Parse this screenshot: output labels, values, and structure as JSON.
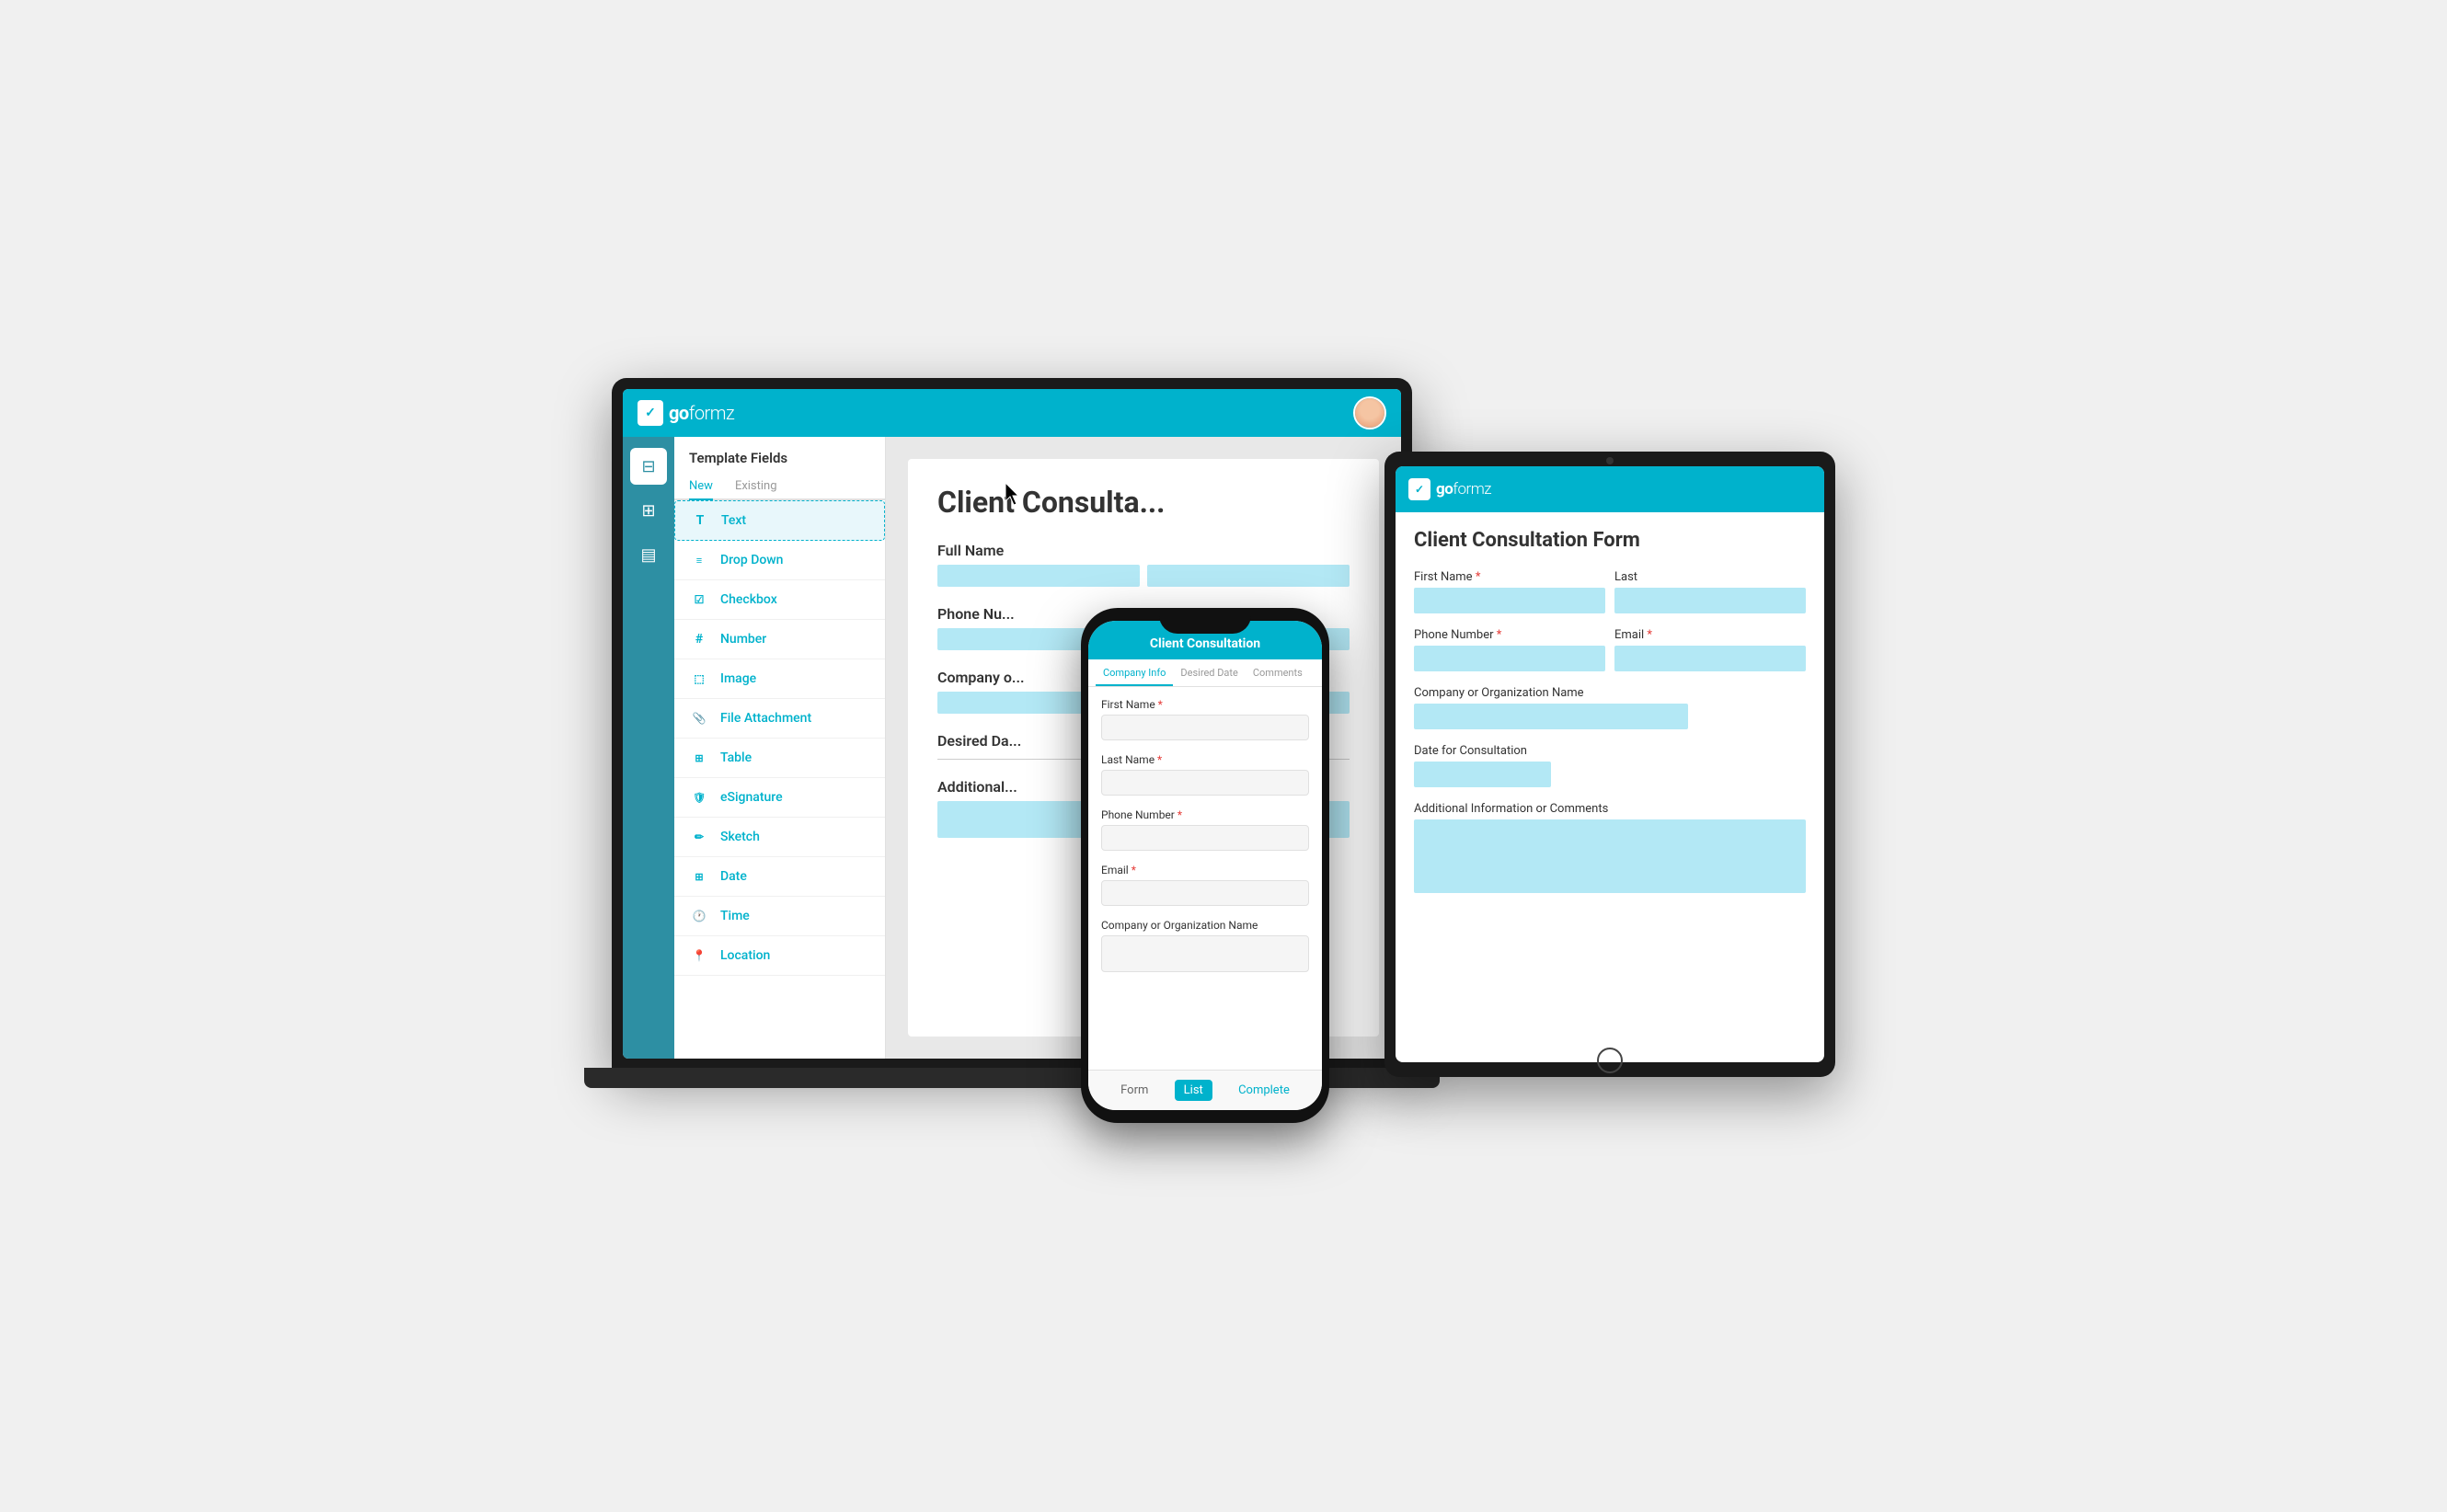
{
  "brand": {
    "name": "goformz",
    "logo_label": "✓"
  },
  "laptop": {
    "topbar_title": "goformz",
    "template_fields_title": "Template Fields",
    "tabs": {
      "new": "New",
      "existing": "Existing"
    },
    "field_types": [
      {
        "id": "text",
        "label": "Text",
        "icon": "T"
      },
      {
        "id": "dropdown",
        "label": "Drop Down",
        "icon": "≡"
      },
      {
        "id": "checkbox",
        "label": "Checkbox",
        "icon": "☑"
      },
      {
        "id": "number",
        "label": "Number",
        "icon": "#"
      },
      {
        "id": "image",
        "label": "Image",
        "icon": "🖼"
      },
      {
        "id": "file-attachment",
        "label": "File Attachment",
        "icon": "📎"
      },
      {
        "id": "table",
        "label": "Table",
        "icon": "⊞"
      },
      {
        "id": "esignature",
        "label": "eSignature",
        "icon": "🛡"
      },
      {
        "id": "sketch",
        "label": "Sketch",
        "icon": "✏"
      },
      {
        "id": "date",
        "label": "Date",
        "icon": "📅"
      },
      {
        "id": "time",
        "label": "Time",
        "icon": "🕐"
      },
      {
        "id": "location",
        "label": "Location",
        "icon": "📍"
      }
    ],
    "form_preview": {
      "title": "Client Consulta...",
      "fields": [
        {
          "label": "Full Name",
          "type": "double"
        },
        {
          "label": "Phone Nu...",
          "type": "single"
        },
        {
          "label": "Company o...",
          "type": "single"
        },
        {
          "label": "Desired Da...",
          "type": "single"
        },
        {
          "label": "Additional...",
          "type": "single"
        }
      ]
    }
  },
  "phone": {
    "title": "Client Consultation",
    "tabs": [
      "Company Info",
      "Desired Date",
      "Comments"
    ],
    "active_tab": "Company Info",
    "fields": [
      {
        "label": "First Name",
        "required": true
      },
      {
        "label": "Last Name",
        "required": true
      },
      {
        "label": "Phone Number",
        "required": true
      },
      {
        "label": "Email",
        "required": true
      },
      {
        "label": "Company or Organization Name",
        "required": false
      }
    ],
    "bottom_buttons": [
      "Form",
      "List",
      "Complete"
    ]
  },
  "tablet": {
    "title": "Client Consultation Form",
    "fields": [
      {
        "label": "First Name",
        "required": true,
        "type": "half",
        "pair_label": "Last",
        "pair_required": false
      },
      {
        "label": "Phone Number",
        "required": true,
        "type": "half",
        "pair_label": "Email",
        "pair_required": true
      },
      {
        "label": "Company or Organization Name",
        "required": false,
        "type": "full"
      },
      {
        "label": "Date for Consultation",
        "required": false,
        "type": "quarter"
      },
      {
        "label": "Additional Information or Comments",
        "required": false,
        "type": "textarea"
      }
    ]
  }
}
